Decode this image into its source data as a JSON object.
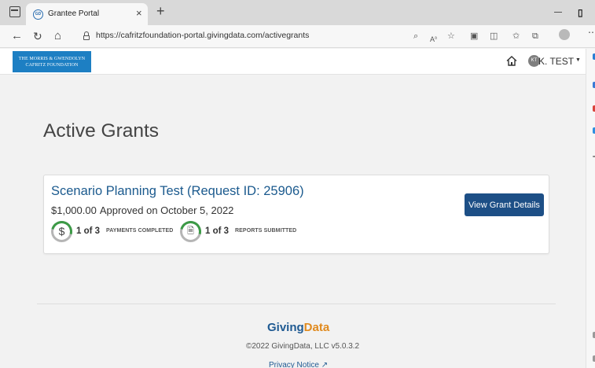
{
  "browser": {
    "tab_title": "Grantee Portal",
    "tab_favicon_text": "GD",
    "url": "https://cafritzfoundation-portal.givingdata.com/activegrants"
  },
  "site": {
    "logo_line1": "THE MORRIS & GWENDOLYN",
    "logo_line2": "CAFRITZ FOUNDATION",
    "user_initials": "KT",
    "user_name": "K. TEST"
  },
  "main": {
    "heading": "Active Grants",
    "grants": [
      {
        "title": "Scenario Planning Test (Request ID: 25906)",
        "amount": "$1,000.00",
        "approved_text": "Approved on October 5, 2022",
        "payments_count": "1 of 3",
        "payments_label": "PAYMENTS COMPLETED",
        "reports_count": "1 of 3",
        "reports_label": "REPORTS SUBMITTED",
        "button_label": "View Grant Details"
      }
    ]
  },
  "footer": {
    "brand_part1": "Giving",
    "brand_part2": "Data",
    "copyright": "©2022 GivingData, LLC v5.0.3.2",
    "privacy": "Privacy Notice"
  },
  "colors": {
    "primary_button": "#1d4f86",
    "link": "#1b5a8e",
    "progress_green": "#3c9a46",
    "logo_blue": "#1d7fc3",
    "brand_orange": "#e08a1e"
  }
}
